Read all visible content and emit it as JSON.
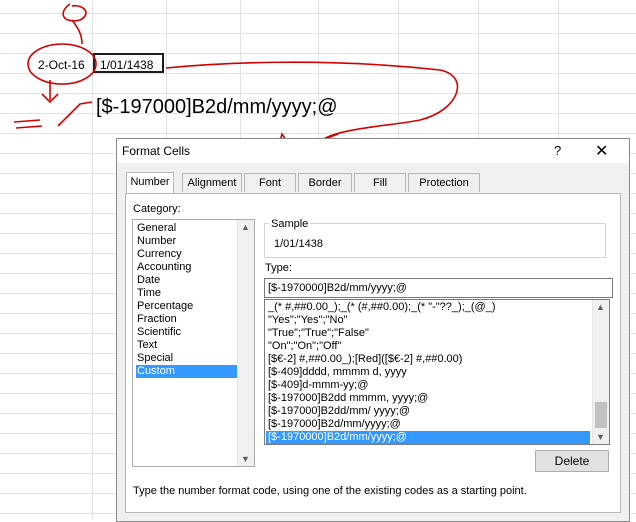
{
  "sheet": {
    "cell_a": "2-Oct-16",
    "cell_b": "1/01/1438",
    "big_text": "[$-197000]B2d/mm/yyyy;@"
  },
  "dialog": {
    "title": "Format Cells",
    "help_label": "?",
    "close_label": "✕",
    "tabs": [
      "Number",
      "Alignment",
      "Font",
      "Border",
      "Fill",
      "Protection"
    ],
    "active_tab": "Number",
    "category_label": "Category:",
    "categories": [
      "General",
      "Number",
      "Currency",
      "Accounting",
      "Date",
      "Time",
      "Percentage",
      "Fraction",
      "Scientific",
      "Text",
      "Special",
      "Custom"
    ],
    "selected_category": "Custom",
    "sample_label": "Sample",
    "sample_value": "1/01/1438",
    "type_label": "Type:",
    "type_value": "[$-1970000]B2d/mm/yyyy;@",
    "type_list": [
      "_(* #,##0.00_);_(* (#,##0.00);_(* \"-\"??_);_(@_)",
      "\"Yes\";\"Yes\";\"No\"",
      "\"True\";\"True\";\"False\"",
      "\"On\";\"On\";\"Off\"",
      "[$€-2] #,##0.00_);[Red]([$€-2] #,##0.00)",
      "[$-409]dddd, mmmm d, yyyy",
      "[$-409]d-mmm-yy;@",
      "[$-197000]B2dd mmmm, yyyy;@",
      "[$-197000]B2dd/mm/ yyyy;@",
      "[$-197000]B2d/mm/yyyy;@",
      "[$-1970000]B2d/mm/yyyy;@"
    ],
    "delete_label": "Delete",
    "hint": "Type the number format code, using one of the existing codes as a starting point."
  },
  "colors": {
    "annotation": "#d40000",
    "selection": "#3399ff"
  }
}
